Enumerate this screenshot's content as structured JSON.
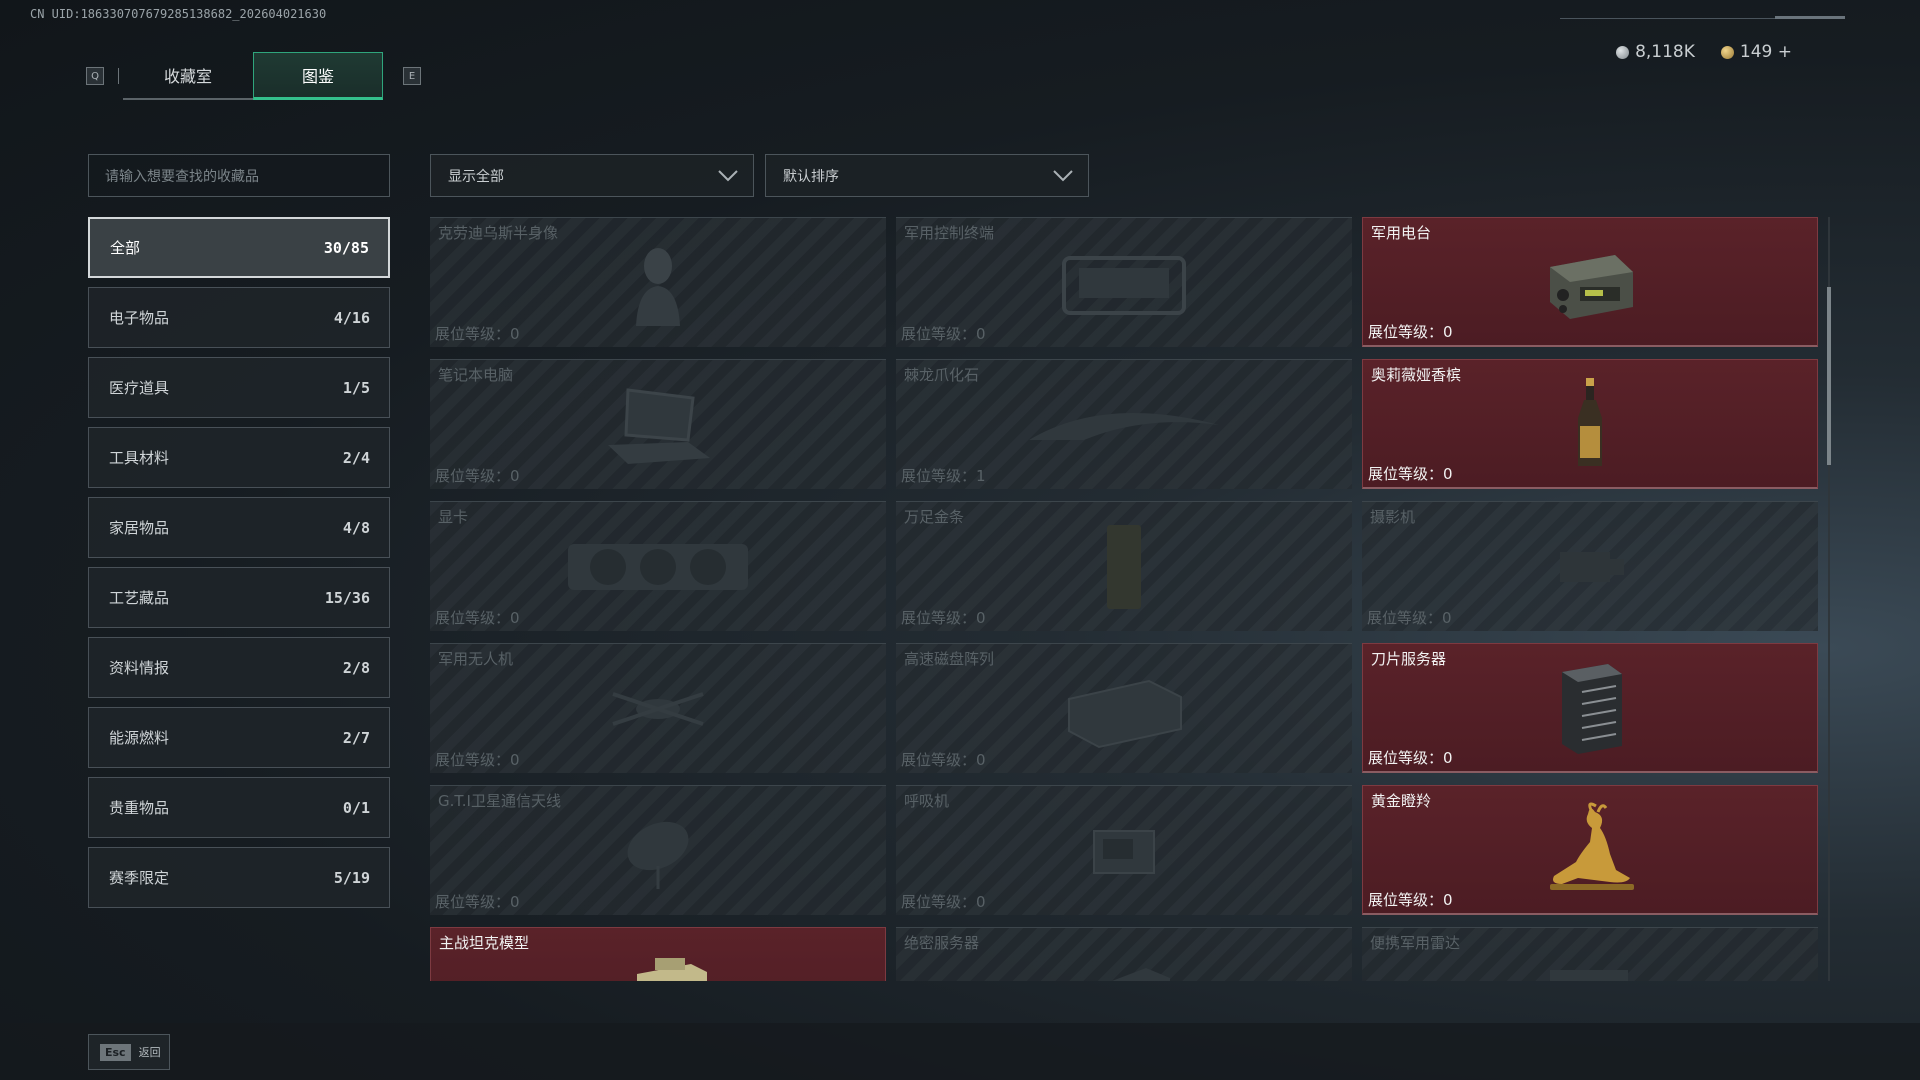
{
  "header": {
    "uid": "CN UID:186330707679285138682_202604021630",
    "tabs": [
      {
        "key": "Q",
        "label": "收藏室",
        "active": false
      },
      {
        "label": "图鉴",
        "active": true,
        "key": "E"
      }
    ],
    "currency": [
      {
        "icon": "silver-coin-icon",
        "value": "8,118K",
        "color": "#9aa2a8"
      },
      {
        "icon": "gold-coin-icon",
        "value": "149 +",
        "color": "#c9a85a"
      }
    ]
  },
  "search": {
    "placeholder": "请输入想要查找的收藏品"
  },
  "filters": {
    "show": "显示全部",
    "sort": "默认排序"
  },
  "categories": [
    {
      "label": "全部",
      "count": "30/85",
      "active": true
    },
    {
      "label": "电子物品",
      "count": "4/16"
    },
    {
      "label": "医疗道具",
      "count": "1/5"
    },
    {
      "label": "工具材料",
      "count": "2/4"
    },
    {
      "label": "家居物品",
      "count": "4/8"
    },
    {
      "label": "工艺藏品",
      "count": "15/36"
    },
    {
      "label": "资料情报",
      "count": "2/8"
    },
    {
      "label": "能源燃料",
      "count": "2/7"
    },
    {
      "label": "贵重物品",
      "count": "0/1"
    },
    {
      "label": "赛季限定",
      "count": "5/19"
    }
  ],
  "items": [
    {
      "name": "克劳迪乌斯半身像",
      "level": "展位等级：0",
      "unlocked": false,
      "icon": "bust-icon"
    },
    {
      "name": "军用控制终端",
      "level": "展位等级：0",
      "unlocked": false,
      "icon": "terminal-icon"
    },
    {
      "name": "军用电台",
      "level": "展位等级：0",
      "unlocked": true,
      "icon": "radio-icon"
    },
    {
      "name": "笔记本电脑",
      "level": "展位等级：0",
      "unlocked": false,
      "icon": "laptop-icon"
    },
    {
      "name": "棘龙爪化石",
      "level": "展位等级：1",
      "unlocked": false,
      "icon": "fossil-icon"
    },
    {
      "name": "奥莉薇娅香槟",
      "level": "展位等级：0",
      "unlocked": true,
      "icon": "champagne-icon"
    },
    {
      "name": "显卡",
      "level": "展位等级：0",
      "unlocked": false,
      "icon": "gpu-icon"
    },
    {
      "name": "万足金条",
      "level": "展位等级：0",
      "unlocked": false,
      "icon": "gold-bar-icon"
    },
    {
      "name": "摄影机",
      "level": "展位等级：0",
      "unlocked": false,
      "icon": "camera-icon"
    },
    {
      "name": "军用无人机",
      "level": "展位等级：0",
      "unlocked": false,
      "icon": "drone-icon"
    },
    {
      "name": "高速磁盘阵列",
      "level": "展位等级：0",
      "unlocked": false,
      "icon": "disk-array-icon"
    },
    {
      "name": "刀片服务器",
      "level": "展位等级：0",
      "unlocked": true,
      "icon": "server-icon"
    },
    {
      "name": "G.T.I卫星通信天线",
      "level": "展位等级：0",
      "unlocked": false,
      "icon": "satellite-dish-icon"
    },
    {
      "name": "呼吸机",
      "level": "展位等级：0",
      "unlocked": false,
      "icon": "ventilator-icon"
    },
    {
      "name": "黄金瞪羚",
      "level": "展位等级：0",
      "unlocked": true,
      "icon": "gazelle-icon"
    },
    {
      "name": "主战坦克模型",
      "level": "",
      "unlocked": true,
      "icon": "tank-icon"
    },
    {
      "name": "绝密服务器",
      "level": "",
      "unlocked": false,
      "icon": "server-icon"
    },
    {
      "name": "便携军用雷达",
      "level": "",
      "unlocked": false,
      "icon": "radar-icon"
    }
  ],
  "footer": {
    "esc_key": "Esc",
    "back_label": "返回"
  }
}
